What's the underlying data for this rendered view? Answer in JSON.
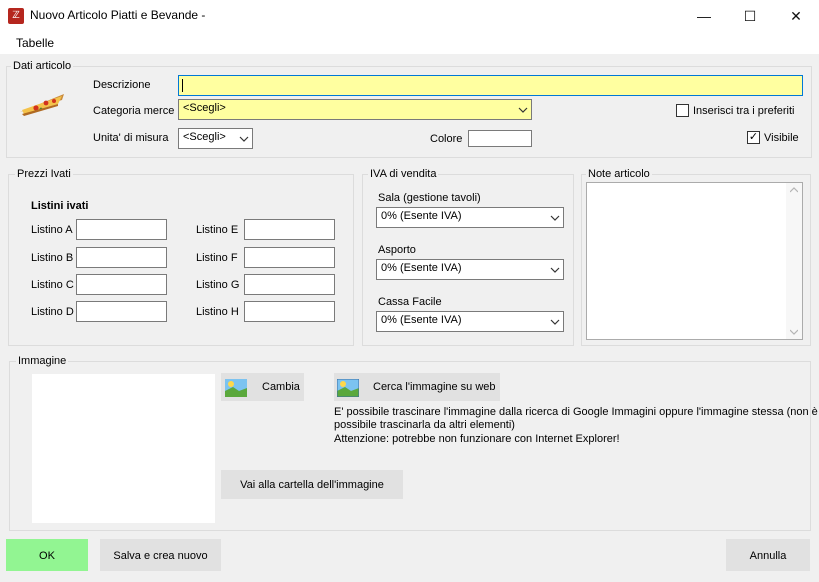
{
  "window": {
    "title": "Nuovo Articolo Piatti e Bevande -",
    "icon_glyph": "ℤ",
    "minimize_glyph": "—",
    "maximize_glyph": "☐",
    "close_glyph": "✕"
  },
  "menu": {
    "tabelle": "Tabelle"
  },
  "dati_articolo": {
    "group_label": "Dati articolo",
    "descrizione_label": "Descrizione",
    "descrizione_value": "",
    "categoria_label": "Categoria merce",
    "categoria_value": "<Scegli>",
    "unita_label": "Unita' di misura",
    "unita_value": "<Scegli>",
    "colore_label": "Colore",
    "preferiti_label": "Inserisci tra i preferiti",
    "preferiti_checked": false,
    "visibile_label": "Visibile",
    "visibile_checked": true,
    "check_glyph": "✓"
  },
  "prezzi": {
    "group_label": "Prezzi Ivati",
    "heading": "Listini ivati",
    "left": [
      "Listino A",
      "Listino B",
      "Listino C",
      "Listino D"
    ],
    "right": [
      "Listino E",
      "Listino F",
      "Listino G",
      "Listino H"
    ]
  },
  "iva": {
    "group_label": "IVA di vendita",
    "sala_label": "Sala (gestione tavoli)",
    "sala_value": "0% (Esente IVA)",
    "asporto_label": "Asporto",
    "asporto_value": "0% (Esente IVA)",
    "cassa_label": "Cassa Facile",
    "cassa_value": "0% (Esente IVA)"
  },
  "note": {
    "group_label": "Note articolo"
  },
  "immagine": {
    "group_label": "Immagine",
    "cambia": "Cambia",
    "cerca": "Cerca l'immagine su web",
    "info_1": "E' possibile trascinare l'immagine dalla ricerca di Google Immagini oppure l'immagine stessa (non è",
    "info_2": "possibile trascinarla da altri elementi)",
    "info_3": "Attenzione: potrebbe non funzionare con Internet Explorer!",
    "vai": "Vai alla cartella dell'immagine"
  },
  "footer": {
    "ok": "OK",
    "salva": "Salva e crea nuovo",
    "annulla": "Annulla"
  },
  "colors": {
    "required_field": "#ffffa0",
    "ok_button": "#92f592",
    "app_icon": "#b5261e"
  }
}
